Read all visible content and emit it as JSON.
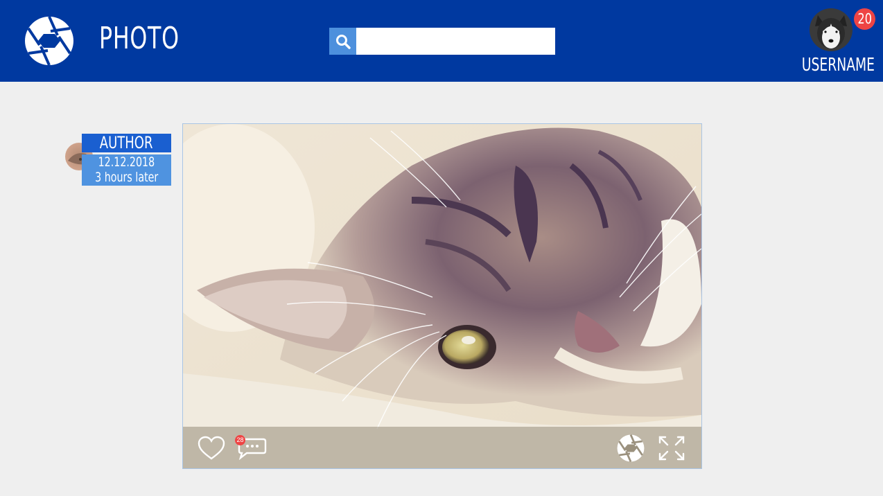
{
  "header": {
    "app_title": "PHOTO",
    "search": {
      "value": "",
      "placeholder": ""
    },
    "username": "USERNAME",
    "notification_count": "20"
  },
  "post": {
    "author": "AUTHOR",
    "date": "12.12.2018",
    "relative_time": "3 hours later",
    "comment_count": "28"
  },
  "icons": {
    "logo": "aperture-icon",
    "search": "search-icon",
    "like": "heart-icon",
    "comment": "comment-icon",
    "share": "aperture-icon",
    "fullscreen": "expand-icon"
  },
  "colors": {
    "header_bg": "#0039a0",
    "search_button": "#4d90dd",
    "badge": "#ee4444",
    "author_label": "#1a5fd0",
    "date_box": "#4f93e0",
    "page_bg": "#efefef"
  }
}
